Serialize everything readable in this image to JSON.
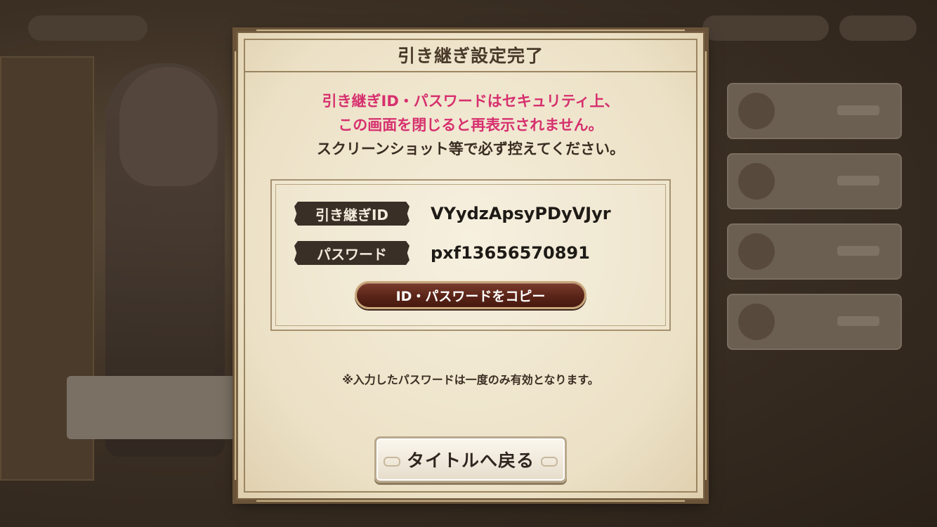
{
  "dialog": {
    "title": "引き継ぎ設定完了",
    "warning_line1": "引き継ぎID・パスワードはセキュリティ上、",
    "warning_line2": "この画面を閉じると再表示されません。",
    "instruction": "スクリーンショット等で必ず控えてください。",
    "credentials": {
      "id_label": "引き継ぎID",
      "id_value": "VYydzApsyPDyVJyr",
      "password_label": "パスワード",
      "password_value": "pxf13656570891"
    },
    "copy_button": "ID・パスワードをコピー",
    "note": "※入力したパスワードは一度のみ有効となります。",
    "back_button": "タイトルへ戻る"
  },
  "colors": {
    "warning": "#d6306e",
    "copy_button": "#5a2418",
    "label_background": "#3a2f27"
  }
}
